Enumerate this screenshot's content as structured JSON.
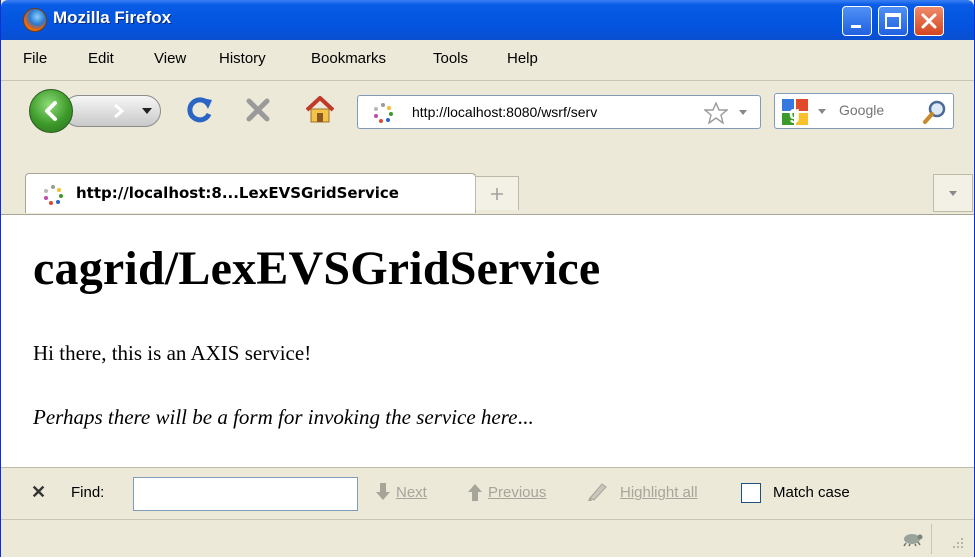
{
  "window": {
    "title": "Mozilla Firefox"
  },
  "menu": [
    "File",
    "Edit",
    "View",
    "History",
    "Bookmarks",
    "Tools",
    "Help"
  ],
  "nav": {
    "url": "http://localhost:8080/wsrf/serv",
    "search_placeholder": "Google"
  },
  "tab": {
    "label": "http://localhost:8...LexEVSGridService"
  },
  "content": {
    "heading": "cagrid/LexEVSGridService",
    "paragraph1": "Hi there, this is an AXIS service!",
    "paragraph2": "Perhaps there will be a form for invoking the service here",
    "paragraph2_ellipsis": "..."
  },
  "findbar": {
    "label": "Find:",
    "value": "",
    "next": "Next",
    "previous": "Previous",
    "highlight": "Highlight all",
    "match_case": "Match case"
  },
  "colors": {
    "titlebar": "#0458e0",
    "chrome": "#ece9d8",
    "reload": "#2a64c4",
    "close": "#d44520"
  }
}
